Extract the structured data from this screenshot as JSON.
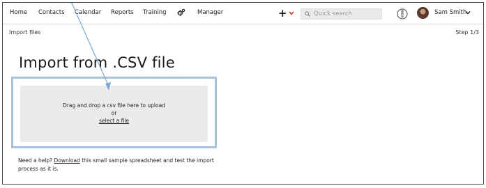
{
  "nav": {
    "items": [
      {
        "label": "Home"
      },
      {
        "label": "Contacts"
      },
      {
        "label": "Calendar"
      },
      {
        "label": "Reports"
      },
      {
        "label": "Training"
      },
      {
        "label": "Manager"
      }
    ],
    "search_placeholder": "Quick search",
    "user_name": "Sam Smith",
    "accent_color": "#e03030"
  },
  "subheader": {
    "breadcrumb": "Import files",
    "step": "Step 1/3"
  },
  "main": {
    "title": "Import from .CSV file",
    "dropzone": {
      "line1": "Drag and drop a csv file here to upload",
      "line2": "or",
      "link": "select a file"
    },
    "help": {
      "prefix": "Need a help? ",
      "link": "Download",
      "suffix": " this small sample spreadsheet and test the import process as it is."
    }
  }
}
